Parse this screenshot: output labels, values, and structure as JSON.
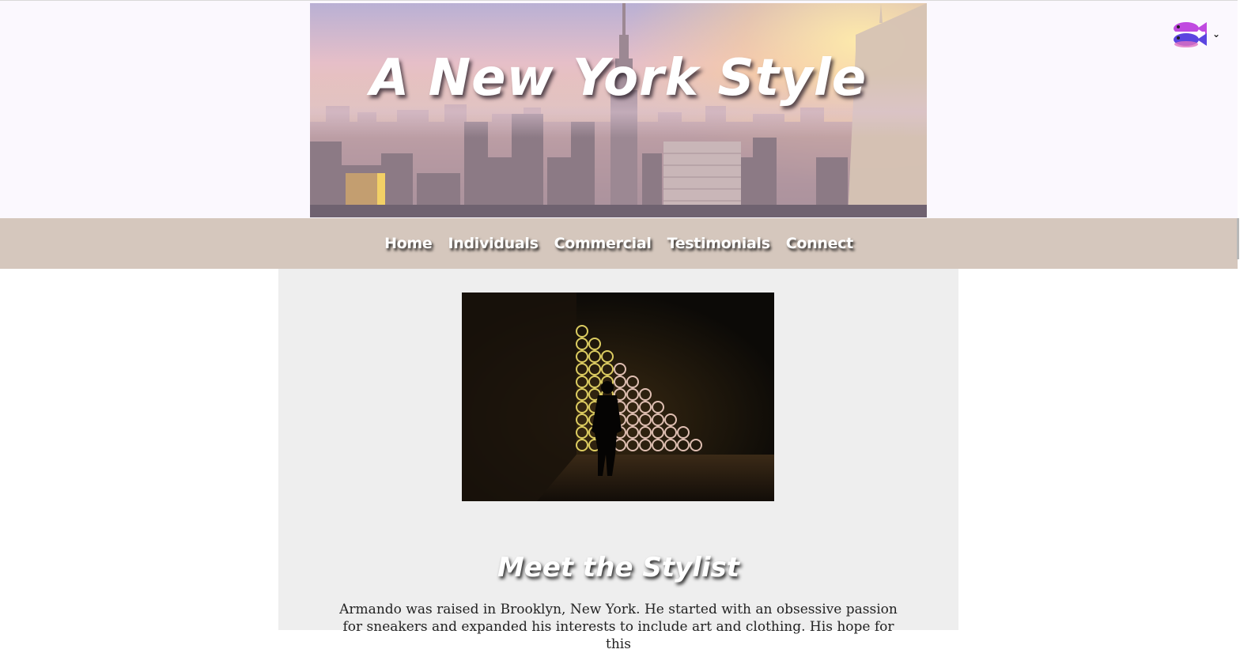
{
  "banner": {
    "title": "A New York Style"
  },
  "language_switcher": {
    "icon": "fish-flag-icon",
    "chevron": "⌄"
  },
  "nav": {
    "items": [
      {
        "label": "Home"
      },
      {
        "label": "Individuals"
      },
      {
        "label": "Commercial"
      },
      {
        "label": "Testimonials"
      },
      {
        "label": "Connect"
      }
    ]
  },
  "main": {
    "heading": "Meet the Stylist",
    "bio": "Armando was raised in Brooklyn, New York. He started with an obsessive passion for sneakers and expanded his interests to include art and clothing. His hope for this"
  },
  "colors": {
    "nav_bg": "#d5c7bd",
    "content_bg": "#eeeeee",
    "header_bg": "#fbf8fe"
  }
}
